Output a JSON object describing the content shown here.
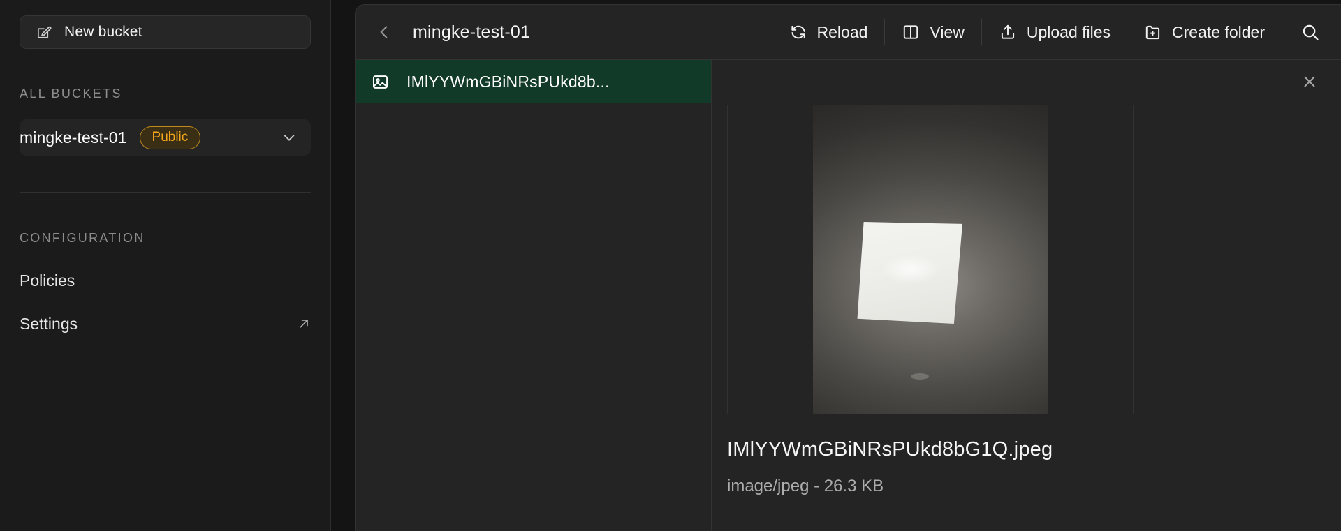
{
  "sidebar": {
    "new_bucket": {
      "label": "New bucket",
      "icon": "edit-square-icon"
    },
    "all_buckets_title": "ALL BUCKETS",
    "bucket": {
      "name": "mingke-test-01",
      "badge": "Public",
      "badge_color": "#f4a71d",
      "chevron": "chevron-down-icon"
    },
    "configuration_title": "CONFIGURATION",
    "config_items": [
      {
        "label": "Policies",
        "external": false
      },
      {
        "label": "Settings",
        "external": true,
        "icon": "external-link-icon"
      }
    ]
  },
  "toolbar": {
    "back_icon": "chevron-left-icon",
    "breadcrumb": "mingke-test-01",
    "actions": [
      {
        "label": "Reload",
        "icon": "reload-icon"
      },
      {
        "label": "View",
        "icon": "split-view-icon"
      },
      {
        "label": "Upload files",
        "icon": "upload-icon"
      },
      {
        "label": "Create folder",
        "icon": "folder-plus-icon"
      }
    ],
    "search_icon": "search-icon"
  },
  "file_list": {
    "items": [
      {
        "name": "IMlYYWmGBiNRsPUkd8b...",
        "icon": "image-icon",
        "selected": true,
        "selected_bg": "#123a28"
      }
    ]
  },
  "detail": {
    "close_icon": "close-icon",
    "preview_alt": "photo of a glowing square ceiling light panel in a dark room",
    "file_name": "IMlYYWmGBiNRsPUkd8bG1Q.jpeg",
    "file_meta": "image/jpeg - 26.3 KB"
  },
  "theme": {
    "app_bg": "#141414",
    "sidebar_bg": "#1b1b1b",
    "card_bg": "#242424",
    "border": "#333333",
    "text": "#f2f2f2",
    "muted_text": "#8d8d8d",
    "accent_green": "#123a28",
    "accent_amber": "#f4a71d"
  }
}
